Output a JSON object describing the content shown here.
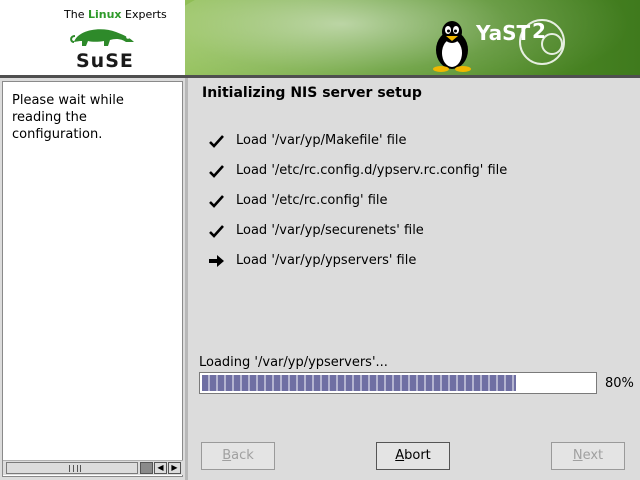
{
  "header": {
    "tagline_prefix": "The ",
    "tagline_brand": "Linux",
    "tagline_suffix": " Experts",
    "suse_logo_text": "SuSE",
    "yast_logo_text": "YaST",
    "yast_version": "2"
  },
  "help": {
    "text": "Please wait while\nreading the configuration."
  },
  "main": {
    "title": "Initializing NIS server setup",
    "steps": [
      {
        "label": "Load '/var/yp/Makefile' file",
        "status": "done",
        "icon": "checkmark-icon"
      },
      {
        "label": "Load '/etc/rc.config.d/ypserv.rc.config' file",
        "status": "done",
        "icon": "checkmark-icon"
      },
      {
        "label": "Load '/etc/rc.config' file",
        "status": "done",
        "icon": "checkmark-icon"
      },
      {
        "label": "Load '/var/yp/securenets' file",
        "status": "done",
        "icon": "checkmark-icon"
      },
      {
        "label": "Load '/var/yp/ypservers' file",
        "status": "current",
        "icon": "arrow-right-icon"
      }
    ],
    "status_label": "Loading '/var/yp/ypservers'...",
    "progress_fraction": 0.8,
    "progress_text": "80%"
  },
  "buttons": {
    "back": {
      "label": "Back",
      "mnemonic": "B",
      "rest": "ack",
      "enabled": false
    },
    "abort": {
      "label": "Abort",
      "mnemonic": "A",
      "rest": "bort",
      "enabled": true
    },
    "next": {
      "label": "Next",
      "mnemonic": "N",
      "rest": "ext",
      "enabled": false
    }
  },
  "colors": {
    "banner_green": "#5f9a2f",
    "progress_fill": "#6f6fa3",
    "background": "#dcdcdc"
  }
}
